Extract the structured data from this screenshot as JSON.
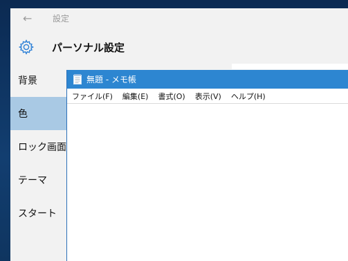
{
  "settings": {
    "window_title": "設定",
    "page_title": "パーソナル設定",
    "nav_items": [
      {
        "label": "背景"
      },
      {
        "label": "色"
      },
      {
        "label": "ロック画面"
      },
      {
        "label": "テーマ"
      },
      {
        "label": "スタート"
      }
    ],
    "selected_index": 1,
    "accent_color": "#a9c9e4"
  },
  "notepad": {
    "title": "無題 - メモ帳",
    "menu": [
      "ファイル(F)",
      "編集(E)",
      "書式(O)",
      "表示(V)",
      "ヘルプ(H)"
    ],
    "titlebar_color": "#2d86d1",
    "content": ""
  }
}
